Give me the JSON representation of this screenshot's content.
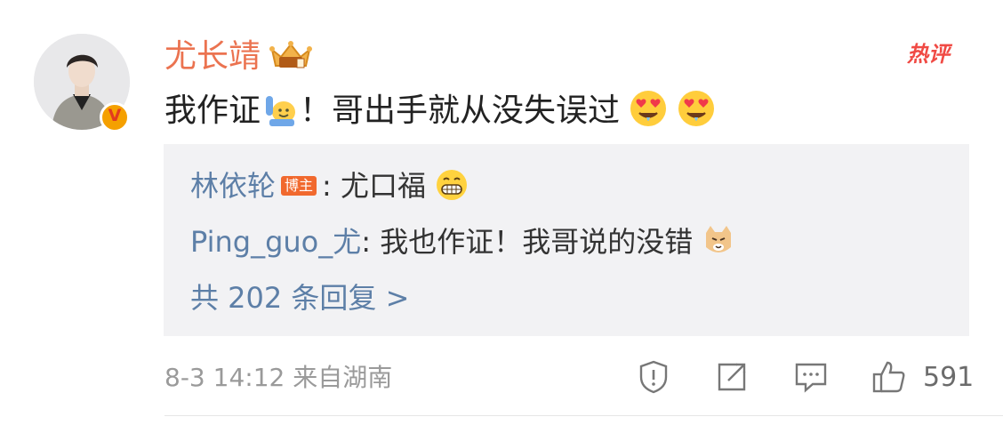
{
  "comment": {
    "username": "尤长靖",
    "hot_tag": "热评",
    "text_part1": "我作证",
    "text_part2": "！哥出手就从没失误过",
    "verified_badge": "V"
  },
  "replies": [
    {
      "user": "林依轮",
      "badge": "博主",
      "text": ": 尤口福"
    },
    {
      "user": "Ping_guo_尤",
      "text": ": 我也作证！我哥说的没错"
    }
  ],
  "more_replies": "共 202 条回复 >",
  "footer": {
    "meta": "8-3 14:12  来自湖南",
    "like_count": "591"
  },
  "icons": [
    "crown-icon",
    "raise-hand-emoji",
    "heart-eyes-emoji",
    "grin-emoji",
    "cat-emoji",
    "report-icon",
    "share-icon",
    "comment-icon",
    "like-icon"
  ]
}
